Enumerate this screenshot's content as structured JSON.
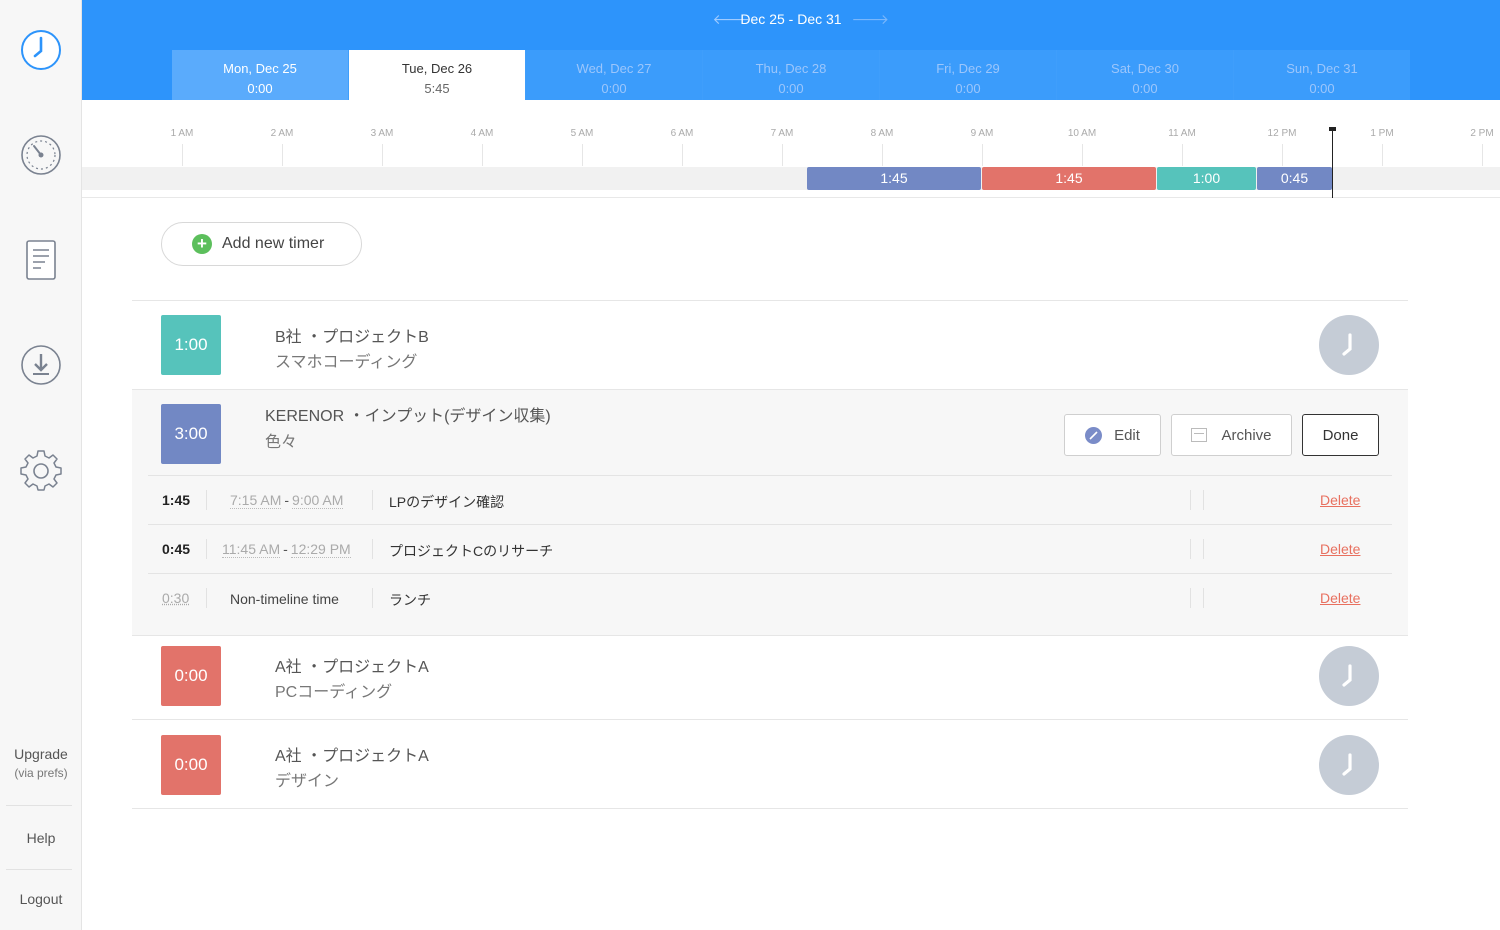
{
  "sidebar": {
    "icons": [
      "clock-icon",
      "dashboard-icon",
      "report-icon",
      "download-icon",
      "gear-icon"
    ],
    "upgrade_label": "Upgrade",
    "upgrade_sub": "(via prefs)",
    "help_label": "Help",
    "logout_label": "Logout"
  },
  "header": {
    "week_range": "Dec 25 - Dec 31",
    "prev_icon": "arrow-left-icon",
    "next_icon": "arrow-right-icon",
    "days": [
      {
        "date": "Mon, Dec 25",
        "total": "0:00"
      },
      {
        "date": "Tue, Dec 26",
        "total": "5:45"
      },
      {
        "date": "Wed, Dec 27",
        "total": "0:00"
      },
      {
        "date": "Thu, Dec 28",
        "total": "0:00"
      },
      {
        "date": "Fri, Dec 29",
        "total": "0:00"
      },
      {
        "date": "Sat, Dec 30",
        "total": "0:00"
      },
      {
        "date": "Sun, Dec 31",
        "total": "0:00"
      }
    ]
  },
  "timeline": {
    "ticks": [
      "1 AM",
      "2 AM",
      "3 AM",
      "4 AM",
      "5 AM",
      "6 AM",
      "7 AM",
      "8 AM",
      "9 AM",
      "10 AM",
      "11 AM",
      "12 PM",
      "1 PM",
      "2 PM"
    ],
    "segments": [
      {
        "label": "1:45",
        "color": "#7288c4"
      },
      {
        "label": "1:45",
        "color": "#e2736a"
      },
      {
        "label": "1:00",
        "color": "#56c3bb"
      },
      {
        "label": "0:45",
        "color": "#7288c4"
      }
    ]
  },
  "add_timer_label": "Add new timer",
  "timers": [
    {
      "duration": "1:00",
      "color": "#56c3bb",
      "title": "B社 ・プロジェクトB",
      "subtitle": "スマホコーディング"
    },
    {
      "duration": "3:00",
      "color": "#7288c4",
      "title": "KERENOR ・インプット(デザイン収集)",
      "subtitle": "色々",
      "actions": {
        "edit": "Edit",
        "archive": "Archive",
        "done": "Done"
      },
      "entries": [
        {
          "duration": "1:45",
          "start": "7:15 AM",
          "end": "9:00 AM",
          "note": "LPのデザイン確認",
          "delete": "Delete"
        },
        {
          "duration": "0:45",
          "start": "11:45 AM",
          "end": "12:29 PM",
          "note": "プロジェクトCのリサーチ",
          "delete": "Delete"
        },
        {
          "duration": "0:30",
          "nontime": "Non-timeline time",
          "note": "ランチ",
          "delete": "Delete"
        }
      ]
    },
    {
      "duration": "0:00",
      "color": "#e2736a",
      "title": "A社 ・プロジェクトA",
      "subtitle": "PCコーディング"
    },
    {
      "duration": "0:00",
      "color": "#e2736a",
      "title": "A社 ・プロジェクトA",
      "subtitle": "デザイン"
    }
  ]
}
